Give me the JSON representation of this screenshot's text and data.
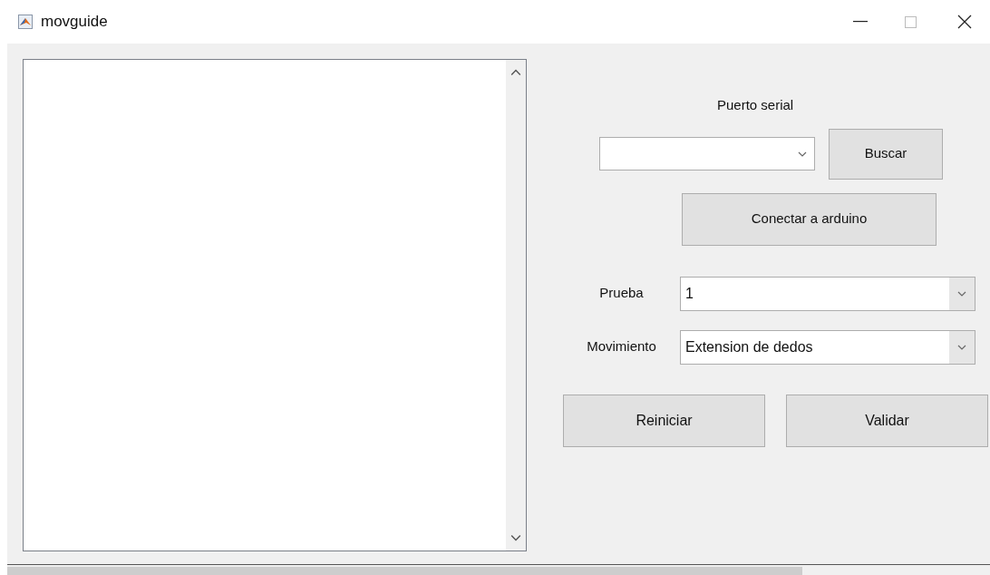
{
  "window": {
    "title": "movguide"
  },
  "serial": {
    "label": "Puerto serial",
    "search_button": "Buscar",
    "connect_button": "Conectar a arduino"
  },
  "fields": [
    {
      "label": "Prueba",
      "value": "1"
    },
    {
      "label": "Movimiento",
      "value": "Extension de dedos"
    }
  ],
  "buttons": [
    "Reiniciar",
    "Validar"
  ]
}
